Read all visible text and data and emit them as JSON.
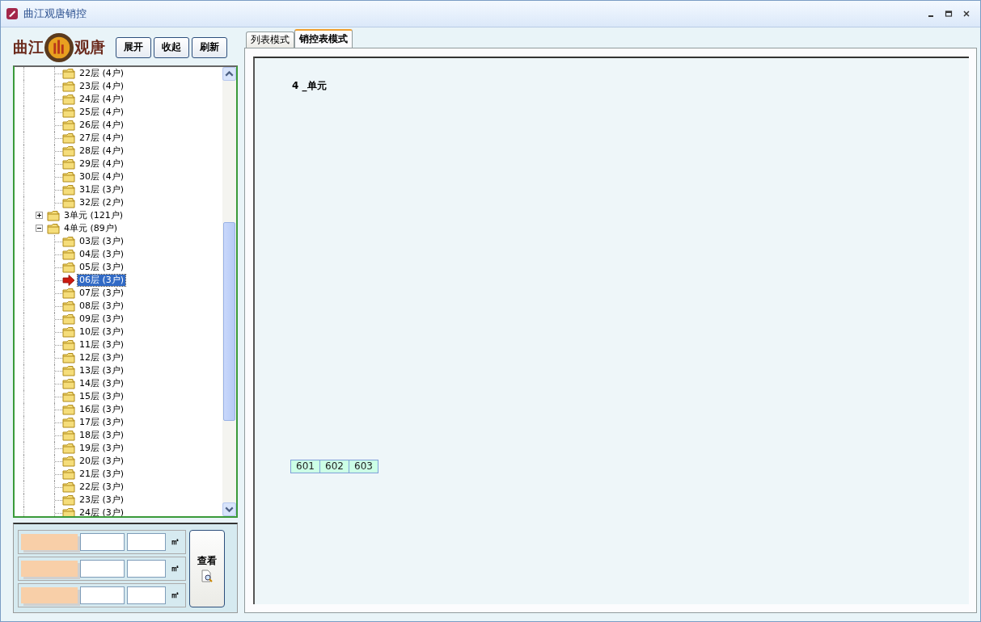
{
  "window": {
    "title": "曲江观唐销控"
  },
  "logo": {
    "left_text": "曲江",
    "right_text": "观唐"
  },
  "toolbar_buttons": [
    "展开",
    "收起",
    "刷新"
  ],
  "tree": {
    "items": [
      {
        "label": "22层 (4户)",
        "selected": false
      },
      {
        "label": "23层 (4户)",
        "selected": false
      },
      {
        "label": "24层 (4户)",
        "selected": false
      },
      {
        "label": "25层 (4户)",
        "selected": false
      },
      {
        "label": "26层 (4户)",
        "selected": false
      },
      {
        "label": "27层 (4户)",
        "selected": false
      },
      {
        "label": "28层 (4户)",
        "selected": false
      },
      {
        "label": "29层 (4户)",
        "selected": false
      },
      {
        "label": "30层 (4户)",
        "selected": false
      },
      {
        "label": "31层 (3户)",
        "selected": false
      },
      {
        "label": "32层 (2户)",
        "selected": false
      }
    ],
    "units": [
      {
        "label": "3单元 (121户)",
        "expanded": false
      },
      {
        "label": "4单元 (89户)",
        "expanded": true,
        "children": [
          {
            "label": "03层 (3户)",
            "selected": false
          },
          {
            "label": "04层 (3户)",
            "selected": false
          },
          {
            "label": "05层 (3户)",
            "selected": false
          },
          {
            "label": "06层 (3户)",
            "selected": true
          },
          {
            "label": "07层 (3户)",
            "selected": false
          },
          {
            "label": "08层 (3户)",
            "selected": false
          },
          {
            "label": "09层 (3户)",
            "selected": false
          },
          {
            "label": "10层 (3户)",
            "selected": false
          },
          {
            "label": "11层 (3户)",
            "selected": false
          },
          {
            "label": "12层 (3户)",
            "selected": false
          },
          {
            "label": "13层 (3户)",
            "selected": false
          },
          {
            "label": "14层 (3户)",
            "selected": false
          },
          {
            "label": "15层 (3户)",
            "selected": false
          },
          {
            "label": "16层 (3户)",
            "selected": false
          },
          {
            "label": "17层 (3户)",
            "selected": false
          },
          {
            "label": "18层 (3户)",
            "selected": false
          },
          {
            "label": "19层 (3户)",
            "selected": false
          },
          {
            "label": "20层 (3户)",
            "selected": false
          },
          {
            "label": "21层 (3户)",
            "selected": false
          },
          {
            "label": "22层 (3户)",
            "selected": false
          },
          {
            "label": "23层 (3户)",
            "selected": false
          },
          {
            "label": "24层 (3户)",
            "selected": false
          }
        ]
      }
    ]
  },
  "area_filters": [
    {
      "unit": "㎡"
    },
    {
      "unit": "㎡"
    },
    {
      "unit": "㎡"
    }
  ],
  "view_button": "查看",
  "tabs": [
    {
      "label": "列表模式",
      "selected": false
    },
    {
      "label": "销控表模式",
      "selected": true
    }
  ],
  "sales_table": {
    "unit_title": "4 _单元",
    "rooms": [
      {
        "number": "601",
        "color": "#ccffe6"
      },
      {
        "number": "602",
        "color": "#ccffe6"
      },
      {
        "number": "603",
        "color": "#ccffe6"
      }
    ]
  }
}
